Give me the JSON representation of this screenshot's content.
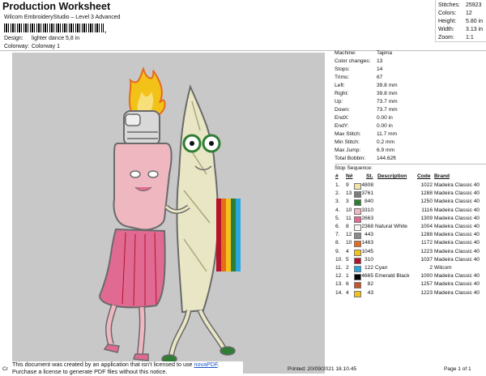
{
  "header": {
    "title": "Production Worksheet",
    "subtitle": "Wilcom EmbroideryStudio – Level 3 Advanced",
    "barcode_suffix": ",",
    "design_label": "Design:",
    "design_value": "lighter dance 5,8 in",
    "colorway_label": "Colorway:",
    "colorway_value": "Colorway 1"
  },
  "summary": [
    {
      "label": "Stitches:",
      "value": "25923"
    },
    {
      "label": "Colors:",
      "value": "12"
    },
    {
      "label": "Height:",
      "value": "5.80 in"
    },
    {
      "label": "Width:",
      "value": "3.13 in"
    },
    {
      "label": "Zoom:",
      "value": "1:1"
    }
  ],
  "machine_info": [
    {
      "label": "Machine:",
      "value": "Tajima"
    },
    {
      "label": "Color changes:",
      "value": "13"
    },
    {
      "label": "Stops:",
      "value": "14"
    },
    {
      "label": "Trims:",
      "value": "67"
    },
    {
      "label": "Left:",
      "value": "39.8 mm"
    },
    {
      "label": "Right:",
      "value": "39.8 mm"
    },
    {
      "label": "Up:",
      "value": "73.7 mm"
    },
    {
      "label": "Down:",
      "value": "73.7 mm"
    },
    {
      "label": "EndX:",
      "value": "0.00 in"
    },
    {
      "label": "EndY:",
      "value": "0.00 in"
    },
    {
      "label": "Max Stitch:",
      "value": "11.7 mm"
    },
    {
      "label": "Min Stitch:",
      "value": "0.2 mm"
    },
    {
      "label": "Max Jump:",
      "value": "6.9 mm"
    },
    {
      "label": "Total Bobbin:",
      "value": "144.62ft"
    }
  ],
  "stop_sequence": {
    "title": "Stop Sequence:",
    "headers": [
      "#",
      "N#",
      "St.",
      "Description",
      "Code",
      "Brand"
    ],
    "rows": [
      {
        "num": "1.",
        "n": "9",
        "color": "#f2e4a8",
        "st": "4808",
        "desc": "",
        "code": "1022",
        "brand": "Madeira Classic 40"
      },
      {
        "num": "2.",
        "n": "13",
        "color": "#7d7d7d",
        "st": "3761",
        "desc": "",
        "code": "1288",
        "brand": "Madeira Classic 40"
      },
      {
        "num": "3.",
        "n": "3",
        "color": "#2f7d35",
        "st": "840",
        "desc": "",
        "code": "1250",
        "brand": "Madeira Classic 40"
      },
      {
        "num": "4.",
        "n": "10",
        "color": "#efb7bf",
        "st": "3310",
        "desc": "",
        "code": "1116",
        "brand": "Madeira Classic 40"
      },
      {
        "num": "5.",
        "n": "11",
        "color": "#e06a92",
        "st": "2663",
        "desc": "",
        "code": "1309",
        "brand": "Madeira Classic 40"
      },
      {
        "num": "6.",
        "n": "8",
        "color": "#f7f5ee",
        "st": "2368",
        "desc": "Natural White",
        "code": "1004",
        "brand": "Madeira Classic 40"
      },
      {
        "num": "7.",
        "n": "12",
        "color": "#8a8a8a",
        "st": "443",
        "desc": "",
        "code": "1288",
        "brand": "Madeira Classic 40"
      },
      {
        "num": "8.",
        "n": "10",
        "color": "#e86a1c",
        "st": "1463",
        "desc": "",
        "code": "1172",
        "brand": "Madeira Classic 40"
      },
      {
        "num": "9.",
        "n": "4",
        "color": "#f2c218",
        "st": "1045",
        "desc": "",
        "code": "1223",
        "brand": "Madeira Classic 40"
      },
      {
        "num": "10.",
        "n": "5",
        "color": "#b5122c",
        "st": "310",
        "desc": "",
        "code": "1037",
        "brand": "Madeira Classic 40"
      },
      {
        "num": "11.",
        "n": "2",
        "color": "#2aa6e0",
        "st": "122",
        "desc": "Cyan",
        "code": "2",
        "brand": "Wilcom"
      },
      {
        "num": "12.",
        "n": "1",
        "color": "#050505",
        "st": "4665",
        "desc": "Emerald Black",
        "code": "1000",
        "brand": "Madeira Classic 40"
      },
      {
        "num": "13.",
        "n": "6",
        "color": "#c0562a",
        "st": "82",
        "desc": "",
        "code": "1257",
        "brand": "Madeira Classic 40"
      },
      {
        "num": "14.",
        "n": "4",
        "color": "#f2c218",
        "st": "43",
        "desc": "",
        "code": "1223",
        "brand": "Madeira Classic 40"
      }
    ]
  },
  "footer": {
    "notice_line1_a": "This document was created by an application that isn’t licensed to use ",
    "notice_link": "novaPDF",
    "notice_line1_b": ".",
    "notice_line2": "Purchase a license to generate PDF files without this notice.",
    "cr": "Cr",
    "printed": "Printed: 20/09/2021 18.10.45",
    "page": "Page 1 of 1"
  },
  "colors": {
    "canvas_bg": "#c8c8c8",
    "link": "#1a55c4"
  }
}
